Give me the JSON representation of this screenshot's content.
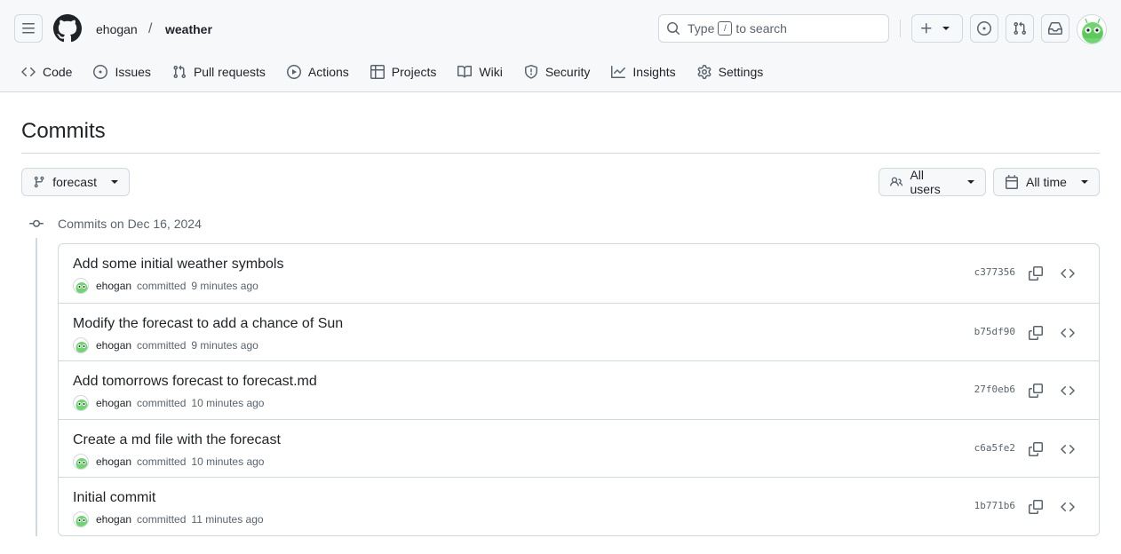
{
  "header": {
    "owner": "ehogan",
    "separator": "/",
    "repo": "weather",
    "search_prefix": "Type",
    "search_key": "/",
    "search_suffix": "to search"
  },
  "tabs": [
    {
      "label": "Code",
      "icon": "code-icon"
    },
    {
      "label": "Issues",
      "icon": "issue-icon"
    },
    {
      "label": "Pull requests",
      "icon": "pull-request-icon"
    },
    {
      "label": "Actions",
      "icon": "play-icon"
    },
    {
      "label": "Projects",
      "icon": "table-icon"
    },
    {
      "label": "Wiki",
      "icon": "book-icon"
    },
    {
      "label": "Security",
      "icon": "shield-icon"
    },
    {
      "label": "Insights",
      "icon": "graph-icon"
    },
    {
      "label": "Settings",
      "icon": "gear-icon"
    }
  ],
  "page": {
    "title": "Commits",
    "branch": "forecast",
    "users_filter": "All users",
    "time_filter": "All time",
    "group_heading": "Commits on Dec 16, 2024"
  },
  "commits": [
    {
      "message": "Add some initial weather symbols",
      "author": "ehogan",
      "verb": "committed",
      "time": "9 minutes ago",
      "sha": "c377356"
    },
    {
      "message": "Modify the forecast to add a chance of Sun",
      "author": "ehogan",
      "verb": "committed",
      "time": "9 minutes ago",
      "sha": "b75df90"
    },
    {
      "message": "Add tomorrows forecast to forecast.md",
      "author": "ehogan",
      "verb": "committed",
      "time": "10 minutes ago",
      "sha": "27f0eb6"
    },
    {
      "message": "Create a md file with the forecast",
      "author": "ehogan",
      "verb": "committed",
      "time": "10 minutes ago",
      "sha": "c6a5fe2"
    },
    {
      "message": "Initial commit",
      "author": "ehogan",
      "verb": "committed",
      "time": "11 minutes ago",
      "sha": "1b771b6"
    }
  ],
  "colors": {
    "header_bg": "#f6f8fa",
    "border": "#d1d9e0",
    "text": "#1f2328",
    "muted": "#59636e",
    "avatar_green": "#6fd66f"
  }
}
